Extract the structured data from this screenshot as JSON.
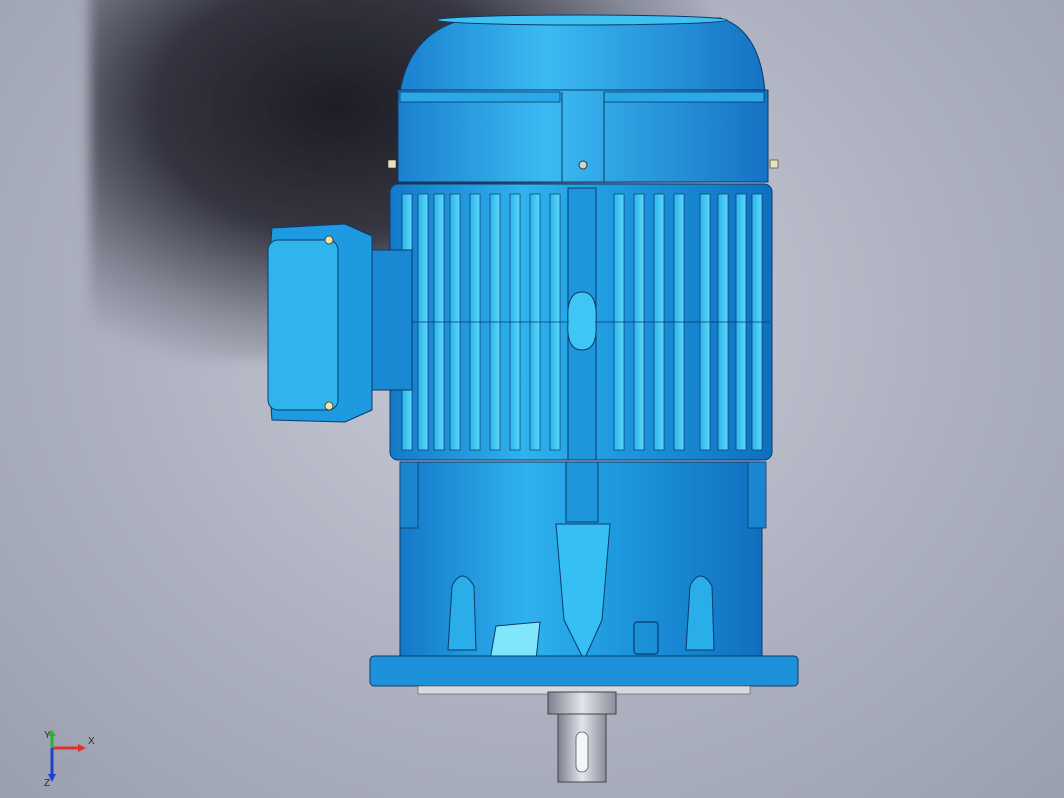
{
  "viewport": {
    "background_color": "#aeb2c0",
    "model_color": "#1fa3e6",
    "highlight_color": "#58d6f5",
    "shadow_color": "#1e1e28"
  },
  "triad": {
    "x_label": "X",
    "y_label": "Y",
    "z_label": "Z",
    "x_color": "#e03030",
    "y_color": "#30b030",
    "z_color": "#2040d0"
  }
}
